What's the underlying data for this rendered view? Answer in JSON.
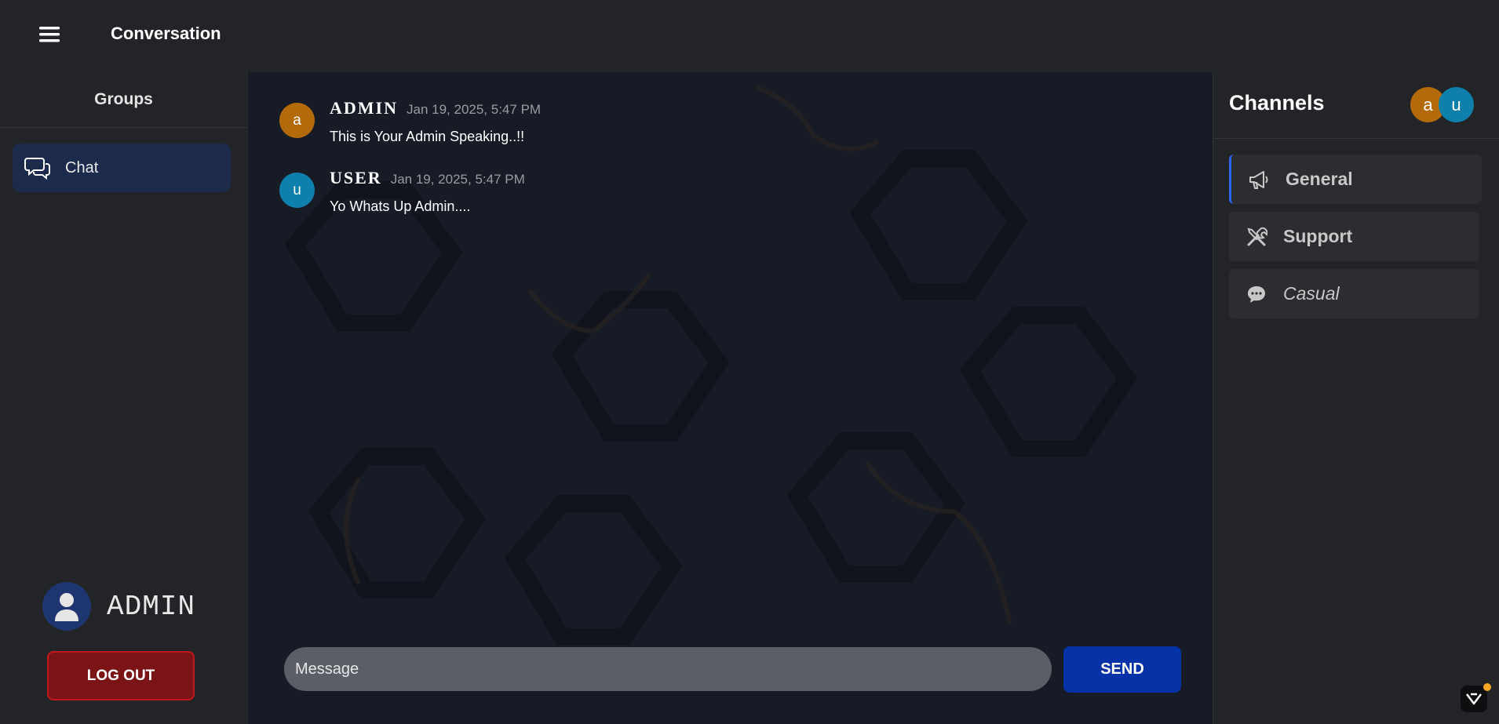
{
  "header": {
    "title": "Conversation"
  },
  "groups": {
    "heading": "Groups",
    "items": [
      {
        "label": "Chat",
        "icon": "chat-bubbles-icon"
      }
    ]
  },
  "profile": {
    "name": "ADMIN",
    "icon": "user-avatar-icon"
  },
  "logout": {
    "label": "LOG OUT"
  },
  "messages": [
    {
      "initial": "a",
      "name": "ADMIN",
      "time": "Jan 19, 2025, 5:47 PM",
      "text": "This is Your Admin Speaking..!!",
      "color": "#b36a0a"
    },
    {
      "initial": "u",
      "name": "USER",
      "time": "Jan 19, 2025, 5:47 PM",
      "text": "Yo Whats Up Admin....",
      "color": "#0f7fab"
    }
  ],
  "composer": {
    "placeholder": "Message",
    "send_label": "SEND"
  },
  "channels": {
    "heading": "Channels",
    "members": [
      {
        "initial": "a",
        "color": "#b36a0a"
      },
      {
        "initial": "u",
        "color": "#0f7fab"
      }
    ],
    "items": [
      {
        "label": "General",
        "icon": "megaphone-icon",
        "active": true
      },
      {
        "label": "Support",
        "icon": "tools-icon",
        "active": false
      },
      {
        "label": "Casual",
        "icon": "speech-bubble-icon",
        "active": false
      }
    ]
  },
  "colors": {
    "accent": "#2c64f0",
    "send": "#0532a6",
    "logout": "#7a1416"
  }
}
